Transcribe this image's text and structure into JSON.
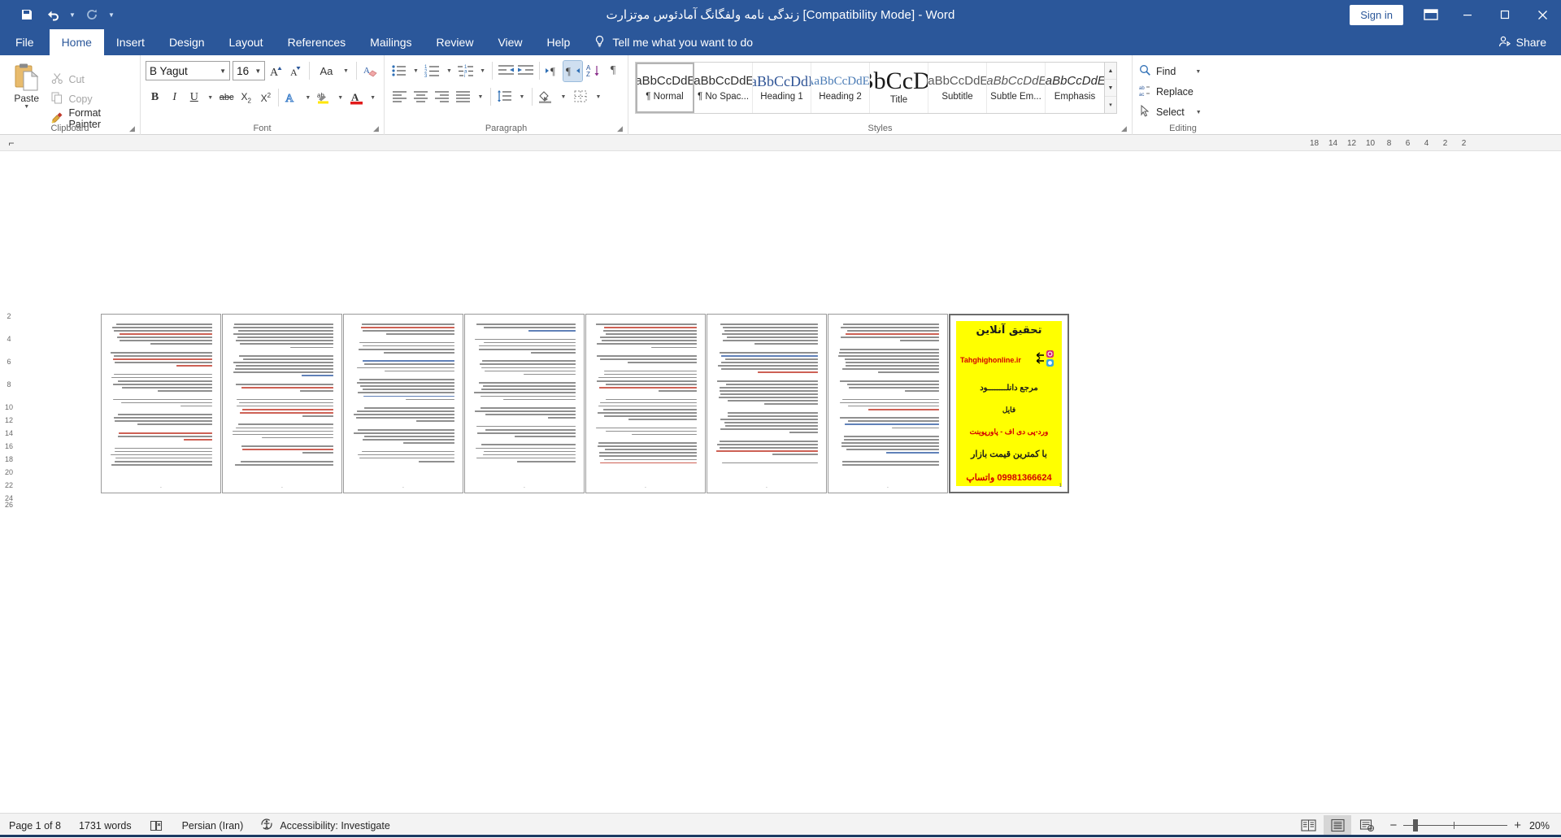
{
  "titlebar": {
    "document_title": "زندگی نامه ولفگانگ آمادئوس موتزارت [Compatibility Mode]  -  Word",
    "signin_label": "Sign in",
    "quick_access": [
      "save-icon",
      "undo-icon",
      "redo-icon",
      "customize-icon"
    ]
  },
  "tabs": [
    {
      "label": "File",
      "key": "file"
    },
    {
      "label": "Home",
      "key": "home"
    },
    {
      "label": "Insert",
      "key": "insert"
    },
    {
      "label": "Design",
      "key": "design"
    },
    {
      "label": "Layout",
      "key": "layout"
    },
    {
      "label": "References",
      "key": "references"
    },
    {
      "label": "Mailings",
      "key": "mailings"
    },
    {
      "label": "Review",
      "key": "review"
    },
    {
      "label": "View",
      "key": "view"
    },
    {
      "label": "Help",
      "key": "help"
    }
  ],
  "active_tab": "Home",
  "tellme": {
    "label": "Tell me what you want to do"
  },
  "share": {
    "label": "Share"
  },
  "ribbon": {
    "clipboard": {
      "group_label": "Clipboard",
      "paste_label": "Paste",
      "cut_label": "Cut",
      "copy_label": "Copy",
      "format_painter_label": "Format Painter"
    },
    "font": {
      "group_label": "Font",
      "font_name": "B Yagut",
      "font_size": "16",
      "grow_label": "A",
      "shrink_label": "A",
      "change_case_label": "Aa",
      "bold_label": "B",
      "italic_label": "I",
      "underline_label": "U",
      "strikethrough_label": "abc",
      "subscript_label": "X",
      "superscript_label": "X",
      "text_effects_label": "A",
      "highlight_label": "ab",
      "font_color_label": "A"
    },
    "paragraph": {
      "group_label": "Paragraph",
      "bullets": "bullets-icon",
      "numbering": "numbering-icon",
      "multilevel": "multilevel-list-icon",
      "decrease_indent": "decrease-indent-icon",
      "increase_indent": "increase-indent-icon",
      "ltr_label": "¶",
      "rtl_label": "¶",
      "sort_label": "A\\nZ",
      "show_marks_label": "¶",
      "align_left": "align-left-icon",
      "align_center": "align-center-icon",
      "align_right": "align-right-icon",
      "justify": "justify-icon",
      "line_spacing": "line-spacing-icon",
      "shading": "shading-icon",
      "borders": "borders-icon"
    },
    "styles": {
      "group_label": "Styles",
      "items": [
        {
          "preview": "AaBbCcDdEe",
          "name": "¶ Normal",
          "selected": true,
          "serif": false
        },
        {
          "preview": "AaBbCcDdEe",
          "name": "¶ No Spac...",
          "selected": false,
          "serif": false
        },
        {
          "preview": "AaBbCcDdEe",
          "name": "Heading 1",
          "selected": false,
          "serif": true
        },
        {
          "preview": "AaBbCcDdEe",
          "name": "Heading 2",
          "selected": false,
          "serif": true
        },
        {
          "preview": "AaBbCcDdEe",
          "name": "Title",
          "selected": false,
          "serif": true
        },
        {
          "preview": "AaBbCcDdEe",
          "name": "Subtitle",
          "selected": false,
          "serif": false
        },
        {
          "preview": "AaBbCcDdEe",
          "name": "Subtle Em...",
          "selected": false,
          "serif": false
        },
        {
          "preview": "AaBbCcDdEe",
          "name": "Emphasis",
          "selected": false,
          "serif": false
        }
      ]
    },
    "editing": {
      "group_label": "Editing",
      "find_label": "Find",
      "replace_label": "Replace",
      "select_label": "Select"
    }
  },
  "ruler": {
    "tab_stop_selector": "tab-stop-left-icon",
    "marks": [
      "18",
      "14",
      "12",
      "10",
      "8",
      "6",
      "4",
      "2",
      "2"
    ]
  },
  "vertical_ruler_marks": [
    "2",
    "4",
    "6",
    "8",
    "10",
    "12",
    "14",
    "16",
    "18",
    "20",
    "22",
    "24",
    "26"
  ],
  "document": {
    "page_count": 8,
    "zoom_percent": "20%",
    "pages": [
      {
        "number": "",
        "kind": "text"
      },
      {
        "number": "",
        "kind": "text"
      },
      {
        "number": "",
        "kind": "text"
      },
      {
        "number": "",
        "kind": "text"
      },
      {
        "number": "",
        "kind": "text"
      },
      {
        "number": "",
        "kind": "text"
      },
      {
        "number": "",
        "kind": "text"
      },
      {
        "number": "1",
        "kind": "ad"
      }
    ],
    "ad_page": {
      "headline": "تحقیق آنلاین",
      "website": "Tahghighonline.ir",
      "line_ref": "مرجع دانلــــــــود",
      "line_file": "فایل",
      "line_formats": "ورد-پی دی اف - پاورپوینت",
      "line_price": "با کمترین قیمت بازار",
      "line_phone": "09981366624 واتساپ",
      "page_label": "1",
      "bg_color": "#ffff00",
      "accent_color": "#d40000"
    }
  },
  "statusbar": {
    "page_indicator": "Page 1 of 8",
    "word_count": "1731 words",
    "proofing_icon": "proofing-errors-icon",
    "language": "Persian (Iran)",
    "accessibility": "Accessibility: Investigate",
    "views": [
      {
        "name": "read-mode-view",
        "selected": false
      },
      {
        "name": "print-layout-view",
        "selected": true
      },
      {
        "name": "web-layout-view",
        "selected": false
      }
    ],
    "zoom_out": "−",
    "zoom_in": "+",
    "zoom_value": "20%"
  }
}
